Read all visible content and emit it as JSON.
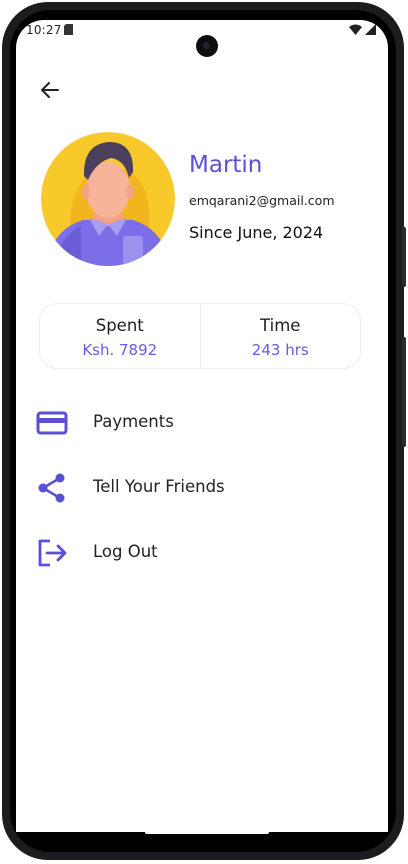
{
  "status_bar": {
    "time": "10:27",
    "icons": [
      "sim-icon",
      "wifi-icon",
      "signal-icon"
    ]
  },
  "header": {
    "back_icon": "arrow-left-icon"
  },
  "profile": {
    "name": "Martin",
    "email": "emqarani2@gmail.com",
    "since": "Since June, 2024",
    "avatar": "person-avatar-illustration"
  },
  "stats": [
    {
      "label": "Spent",
      "value": "Ksh. 7892"
    },
    {
      "label": "Time",
      "value": "243 hrs"
    }
  ],
  "menu": [
    {
      "label": "Payments",
      "icon": "credit-card-icon"
    },
    {
      "label": "Tell Your Friends",
      "icon": "share-icon"
    },
    {
      "label": "Log Out",
      "icon": "logout-icon"
    }
  ],
  "colors": {
    "accent": "#5b4fd6",
    "stat_value": "#6a5ae0",
    "avatar_background": "#f7c92a",
    "shirt": "#7b6ee8",
    "hair": "#4a3f5c",
    "skin": "#f7b49a"
  }
}
